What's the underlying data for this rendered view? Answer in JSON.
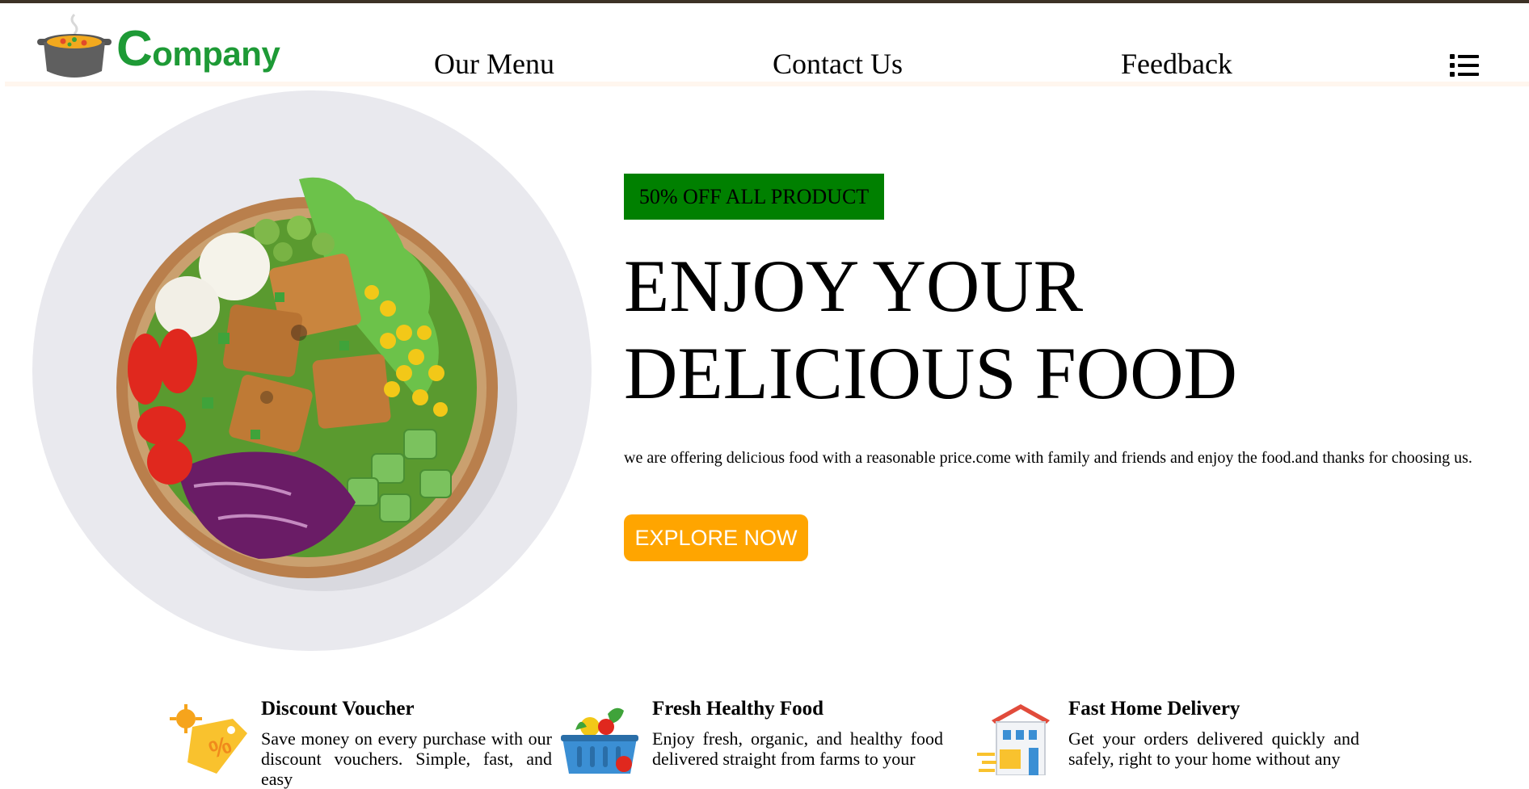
{
  "header": {
    "logo_text_first": "C",
    "logo_text_rest": "ompany",
    "nav": [
      "Our Menu",
      "Contact Us",
      "Feedback"
    ],
    "menu_icon": "list-icon"
  },
  "hero": {
    "badge": "50% OFF ALL PRODUCT",
    "headline_line1": "ENJOY YOUR",
    "headline_line2": "DELICIOUS FOOD",
    "subtext": "we are offering delicious food with a reasonable price.come with family and friends and enjoy the food.and thanks for choosing us.",
    "cta": "EXPLORE NOW",
    "image": "salad-bowl-image"
  },
  "features": [
    {
      "icon": "discount-tag-icon",
      "title": "Discount Voucher",
      "desc": "Save money on every purchase with our discount vouchers. Simple, fast, and easy"
    },
    {
      "icon": "vegetable-basket-icon",
      "title": "Fresh Healthy Food",
      "desc": "Enjoy fresh, organic, and healthy food delivered straight from farms to your"
    },
    {
      "icon": "house-delivery-icon",
      "title": "Fast Home Delivery",
      "desc": "Get your orders delivered quickly and safely, right to your home without any"
    }
  ],
  "colors": {
    "brand_green": "#1e9a36",
    "badge_green": "#008000",
    "cta_orange": "#ffa500",
    "top_bar": "#3d3226"
  }
}
